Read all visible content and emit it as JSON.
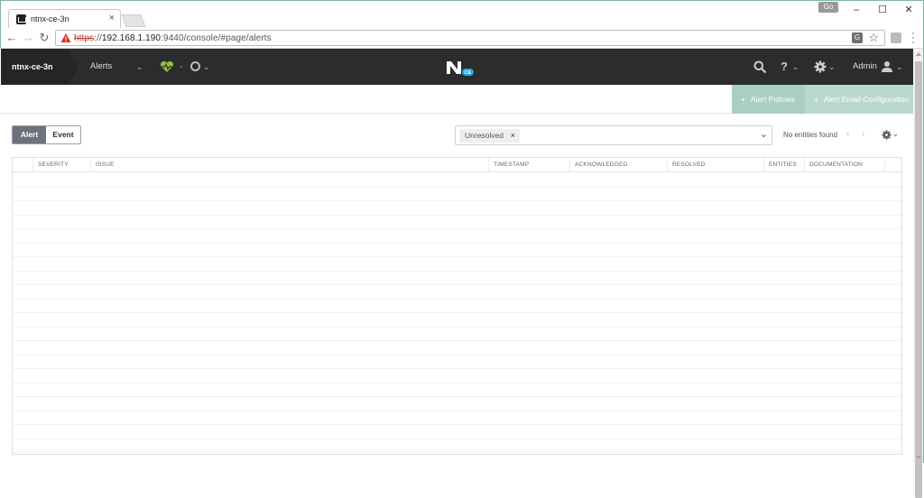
{
  "browser": {
    "tab_title": "ntnx-ce-3n",
    "tab_close": "×",
    "guest_label": "Go",
    "url_protocol": "https",
    "url_host": "192.168.1.190",
    "url_rest": ":9440/console/#page/alerts"
  },
  "header": {
    "cluster_name": "ntnx-ce-3n",
    "page_menu": "Alerts",
    "user_label": "Admin",
    "logo_badge": "CE",
    "help_glyph": "?"
  },
  "actions": {
    "alert_policies": "Alert Policies",
    "alert_email_config": "Alert Email Configuration"
  },
  "toggle": {
    "alert": "Alert",
    "event": "Event",
    "selected": "Alert"
  },
  "filter": {
    "chip_label": "Unresolved",
    "chip_remove": "×",
    "status_text": "No entities found"
  },
  "table": {
    "columns": [
      "SEVERITY",
      "ISSUE",
      "TIMESTAMP",
      "ACKNOWLEDGED",
      "RESOLVED",
      "ENTITIES",
      "DOCUMENTATION"
    ],
    "rows": []
  },
  "colors": {
    "header_bg": "#2b2c2e",
    "accent_green": "#a8cfc0",
    "toggle_active": "#6d737d",
    "health_green": "#8fc43a",
    "logo_blue": "#1ea7e1"
  },
  "icons": {
    "health": "heart-pulse-icon",
    "tasks": "circle-tasks-icon",
    "search": "search-icon",
    "help": "question-icon",
    "settings": "gear-icon",
    "user": "user-icon"
  }
}
